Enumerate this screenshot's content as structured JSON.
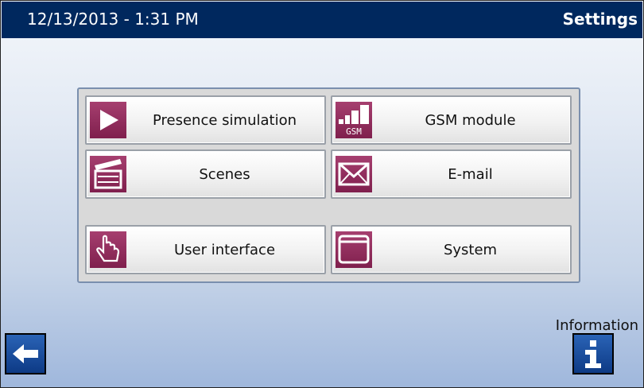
{
  "header": {
    "datetime": "12/13/2013  -  1:31 PM",
    "title": "Settings"
  },
  "menu": {
    "presence_simulation": "Presence simulation",
    "gsm_module": "GSM module",
    "gsm_icon_text": "GSM",
    "scenes": "Scenes",
    "email": "E-mail",
    "user_interface": "User interface",
    "system": "System"
  },
  "footer": {
    "information_label": "Information"
  },
  "colors": {
    "header_bg": "#00285e",
    "icon_bg": "#8e2c5c",
    "nav_button": "#1a4fa0"
  },
  "icons": [
    "play-icon",
    "gsm-signal-icon",
    "clapperboard-icon",
    "envelope-icon",
    "hand-pointer-icon",
    "window-icon",
    "back-arrow-icon",
    "info-icon"
  ]
}
